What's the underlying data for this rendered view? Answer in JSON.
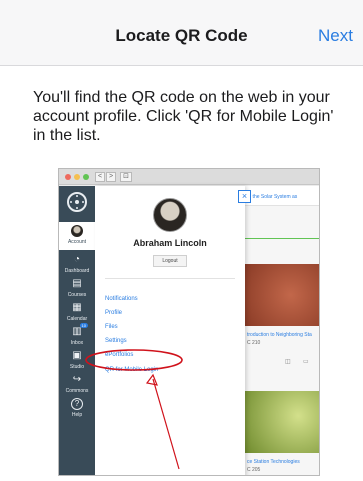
{
  "nav": {
    "title": "Locate QR Code",
    "next_label": "Next"
  },
  "instruction": "You'll find the QR code on the web in your account profile. Click 'QR for Mobile Login' in the list.",
  "illustration": {
    "browser": {
      "back": "<",
      "forward": ">",
      "tab": "⊡"
    },
    "rail": [
      {
        "label": "Account",
        "icon": "avatar"
      },
      {
        "label": "Dashboard",
        "icon": "dashboard-icon"
      },
      {
        "label": "Courses",
        "icon": "book-icon"
      },
      {
        "label": "Calendar",
        "icon": "calendar-icon"
      },
      {
        "label": "Inbox",
        "icon": "inbox-icon",
        "badge": "10"
      },
      {
        "label": "Studio",
        "icon": "studio-icon"
      },
      {
        "label": "Commons",
        "icon": "commons-icon"
      },
      {
        "label": "Help",
        "icon": "help-icon"
      }
    ],
    "tray": {
      "close_label": "×",
      "user_name": "Abraham Lincoln",
      "logout_label": "Logout",
      "links": [
        "Notifications",
        "Profile",
        "Files",
        "Settings",
        "ePortfolios",
        "QR for Mobile Login"
      ]
    },
    "content": {
      "top_link": "to the Solar System as",
      "cards": [
        {
          "title": "troduction to Neighboring Sta",
          "code": "C 210"
        },
        {
          "title": "ce Station Technologies",
          "code": "C 205"
        }
      ]
    },
    "colors": {
      "rail": "#394b58",
      "link": "#2a7de1",
      "annotation": "#d0121b"
    }
  }
}
